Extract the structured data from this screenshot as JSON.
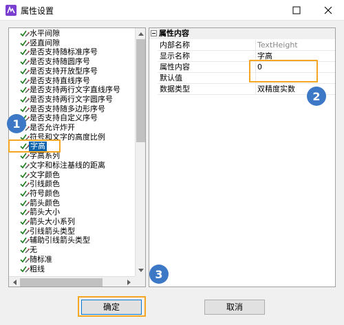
{
  "window": {
    "title": "属性设置"
  },
  "tree": {
    "items": [
      {
        "label": "水平间隙"
      },
      {
        "label": "竖直间隙"
      },
      {
        "label": "是否支持随标准序号"
      },
      {
        "label": "是否支持随圆序号"
      },
      {
        "label": "是否支持开放型序号"
      },
      {
        "label": "是否支持直线序号"
      },
      {
        "label": "是否支持两行文字直线序号"
      },
      {
        "label": "是否支持两行文字圆序号"
      },
      {
        "label": "是否支持随多边形序号"
      },
      {
        "label": "是否支持自定义序号"
      },
      {
        "label": "是否允许炸开"
      },
      {
        "label": "符号和文字的高度比例"
      },
      {
        "label": "字高",
        "selected": true
      },
      {
        "label": "字高系列"
      },
      {
        "label": "文字和标注基线的距离"
      },
      {
        "label": "文字颜色"
      },
      {
        "label": "引线颜色"
      },
      {
        "label": "符号颜色"
      },
      {
        "label": "箭头颜色"
      },
      {
        "label": "箭头大小"
      },
      {
        "label": "箭头大小系列"
      },
      {
        "label": "引线箭头类型"
      },
      {
        "label": "辅助引线箭头类型"
      },
      {
        "label": "无"
      },
      {
        "label": "随标准"
      },
      {
        "label": "粗线"
      }
    ]
  },
  "properties": {
    "category": "属性内容",
    "rows": [
      {
        "name": "内部名称",
        "value": "TextHeight",
        "gray": true
      },
      {
        "name": "显示名称",
        "value": "字高"
      },
      {
        "name": "属性内容",
        "value": "0"
      },
      {
        "name": "默认值",
        "value": ""
      },
      {
        "name": "数据类型",
        "value": "双精度实数"
      }
    ]
  },
  "annotations": {
    "badge1": "1",
    "badge2": "2",
    "badge3": "3",
    "highlight_color": "#f5a623",
    "badge_color": "#3d78c6"
  },
  "buttons": {
    "ok_label": "确定",
    "cancel_label": "取消"
  },
  "icons": {
    "app": "app-icon",
    "tree_item": "checkmark-pencil-icon"
  }
}
